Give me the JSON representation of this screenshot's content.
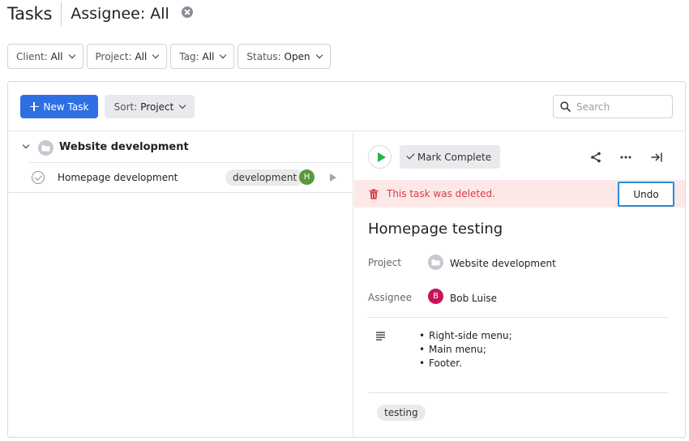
{
  "header": {
    "title": "Tasks",
    "assignee_label": "Assignee: All"
  },
  "filters": [
    {
      "label": "Client:",
      "value": "All"
    },
    {
      "label": "Project:",
      "value": "All"
    },
    {
      "label": "Tag:",
      "value": "All"
    },
    {
      "label": "Status:",
      "value": "Open"
    }
  ],
  "toolbar": {
    "new_task_label": "New Task",
    "sort_label": "Sort:",
    "sort_value": "Project",
    "search_placeholder": "Search"
  },
  "task_list": {
    "group_name": "Website development",
    "tasks": [
      {
        "name": "Homepage development",
        "tag": "development",
        "assignee_initial": "H"
      }
    ]
  },
  "detail": {
    "mark_complete_label": "Mark Complete",
    "deleted_message": "This task was deleted.",
    "undo_label": "Undo",
    "title": "Homepage testing",
    "project_label": "Project",
    "project_value": "Website development",
    "assignee_label": "Assignee",
    "assignee_name": "Bob Luise",
    "assignee_initial": "B",
    "description_items": [
      "Right-side menu;",
      "Main menu;",
      "Footer."
    ],
    "tag": "testing"
  },
  "colors": {
    "primary": "#2f6fe4",
    "danger": "#d93b3b",
    "danger_bg": "#fde8e8",
    "play_green": "#26b34a",
    "avatar_h": "#5a9a3a",
    "avatar_b": "#c4145a",
    "focus_border": "#2a8ad6"
  }
}
